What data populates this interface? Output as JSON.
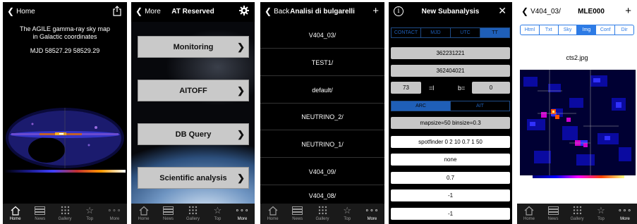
{
  "tabs": [
    {
      "label": "Home",
      "icon": "home-icon"
    },
    {
      "label": "News",
      "icon": "news-icon"
    },
    {
      "label": "Gallery",
      "icon": "gallery-icon"
    },
    {
      "label": "Top",
      "icon": "star-icon"
    },
    {
      "label": "More",
      "icon": "more-icon"
    }
  ],
  "tab_glyphs": {
    "star": "☆",
    "more": "∘∘∘"
  },
  "screen1": {
    "back_label": "Home",
    "title_line1": "The AGILE gamma-ray sky map",
    "title_line2": "in Galactic coordinates",
    "mjd": "MJD 58527.29 58529.29",
    "active_tab": "Home"
  },
  "screen2": {
    "back_label": "More",
    "title": "AT Reserved",
    "buttons": [
      "Monitoring",
      "AITOFF",
      "DB Query",
      "Scientific analysis"
    ],
    "arrow": "❯",
    "active_tab": "More"
  },
  "screen3": {
    "back_label": "Back",
    "title": "Analisi di bulgarelli",
    "add_glyph": "+",
    "items": [
      "V404_03/",
      "TEST1/",
      "default/",
      "NEUTRINO_2/",
      "NEUTRINO_1/",
      "V404_09/",
      "V404_08/"
    ],
    "active_tab": "More"
  },
  "screen4": {
    "info_glyph": "i",
    "title": "New Subanalysis",
    "close_glyph": "✕",
    "time_modes": [
      "CONTACT",
      "MJD",
      "UTC",
      "TT"
    ],
    "time_mode_selected": "TT",
    "t_start": "362231221",
    "t_stop": "362404021",
    "l_value": "73",
    "l_label": "=l",
    "b_label": "b=",
    "b_value": "0",
    "projection_modes": [
      "ARC",
      "AIT"
    ],
    "projection_selected": "ARC",
    "map_params": "mapsize=50 binsize=0.3",
    "spotfinder": "spotfinder 0 2 10 0.7 1 50",
    "fields": [
      "none",
      "0.7",
      "-1",
      "-1"
    ]
  },
  "screen5": {
    "back_label": "V404_03/",
    "title": "MLE000",
    "add_glyph": "+",
    "segments": [
      "Html",
      "Txt",
      "Sky",
      "Img",
      "Conf",
      "Dir"
    ],
    "segment_selected": "Img",
    "file_name": "cts2.jpg",
    "active_tab": "More"
  },
  "colors": {
    "ios_blue": "#2d7be5",
    "button_gray": "#c9c9c9",
    "tab_active": "#ffffff",
    "tab_inactive": "#9a9a9a"
  }
}
